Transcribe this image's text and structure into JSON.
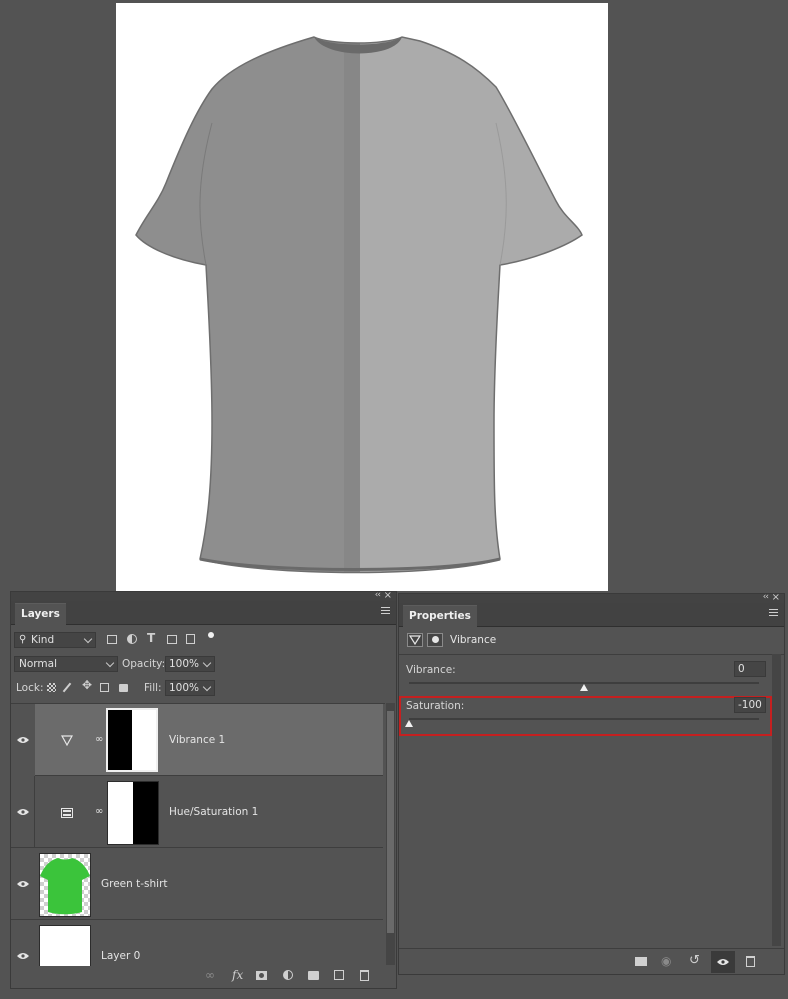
{
  "layers_panel": {
    "tab_label": "Layers",
    "filter_kind": "Kind",
    "blend_mode": "Normal",
    "opacity_label": "Opacity:",
    "opacity_value": "100%",
    "lock_label": "Lock:",
    "fill_label": "Fill:",
    "fill_value": "100%",
    "layers": [
      {
        "name": "Vibrance 1",
        "type": "vibrance-adjustment"
      },
      {
        "name": "Hue/Saturation 1",
        "type": "hue-saturation-adjustment"
      },
      {
        "name": "Green t-shirt",
        "type": "pixel"
      },
      {
        "name": "Layer 0",
        "type": "pixel"
      }
    ]
  },
  "properties_panel": {
    "tab_label": "Properties",
    "adjustment_name": "Vibrance",
    "vibrance_label": "Vibrance:",
    "vibrance_value": "0",
    "saturation_label": "Saturation:",
    "saturation_value": "-100"
  },
  "colors": {
    "highlight": "#c52020",
    "selected_row": "#6b6b6b",
    "tshirt_green": "#3bc43b"
  }
}
